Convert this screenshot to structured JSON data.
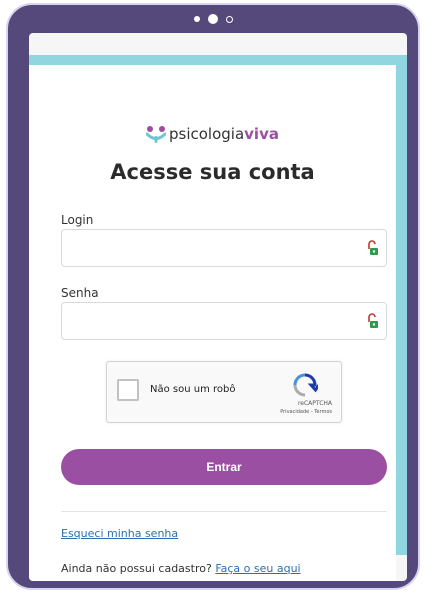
{
  "brand": {
    "name_prefix": "psicologia",
    "name_suffix": "viva",
    "color_primary": "#9b4fa3",
    "color_accent": "#8fd6e1",
    "logo_icon": "psicologiaviva-logo-icon"
  },
  "page": {
    "title": "Acesse sua conta"
  },
  "form": {
    "login_label": "Login",
    "login_value": "",
    "password_label": "Senha",
    "password_value": "",
    "field_icon": "password-manager-key-icon",
    "submit_label": "Entrar"
  },
  "recaptcha": {
    "label": "Não sou um robô",
    "brand": "reCAPTCHA",
    "links": "Privacidade - Termos",
    "checked": false
  },
  "footer": {
    "forgot_password": "Esqueci minha senha",
    "signup_prompt": "Ainda não possui cadastro?",
    "signup_link": "Faça o seu aqui"
  }
}
